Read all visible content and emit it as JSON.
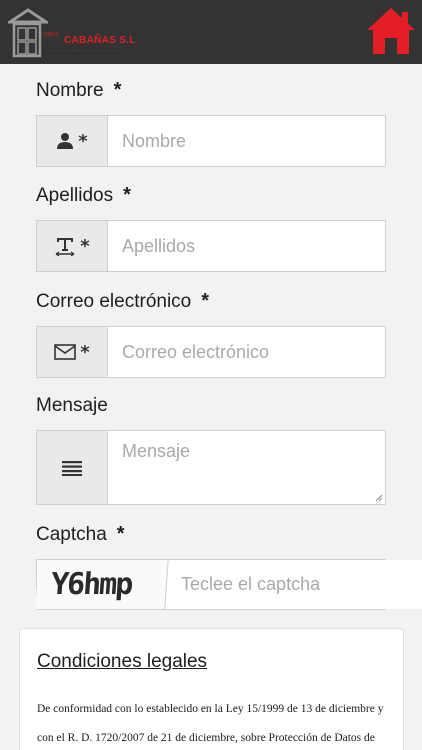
{
  "header": {
    "logo_small": "HNOS",
    "logo_name": "CABAÑAS S.L",
    "home_icon": "home-icon",
    "accent_color": "#e31e24",
    "bar_color": "#333333"
  },
  "form": {
    "nombre": {
      "label": "Nombre",
      "required": "*",
      "addon_icon": "user-icon",
      "addon_star": "*",
      "placeholder": "Nombre"
    },
    "apellidos": {
      "label": "Apellidos",
      "required": "*",
      "addon_icon": "text-type-icon",
      "addon_star": "*",
      "placeholder": "Apellidos"
    },
    "correo": {
      "label": "Correo electrónico",
      "required": "*",
      "addon_icon": "envelope-icon",
      "addon_star": "*",
      "placeholder": "Correo electrónico"
    },
    "mensaje": {
      "label": "Mensaje",
      "addon_icon": "lines-icon",
      "placeholder": "Mensaje"
    },
    "captcha": {
      "label": "Captcha",
      "required": "*",
      "code": "Y6hmp",
      "placeholder": "Teclee el captcha"
    }
  },
  "legal": {
    "title": "Condiciones legales",
    "text": "De conformidad con lo establecido en la Ley 15/1999 de 13 de diciembre y con el R. D. 1720/2007 de 21 de diciembre, sobre Protección de Datos de"
  }
}
